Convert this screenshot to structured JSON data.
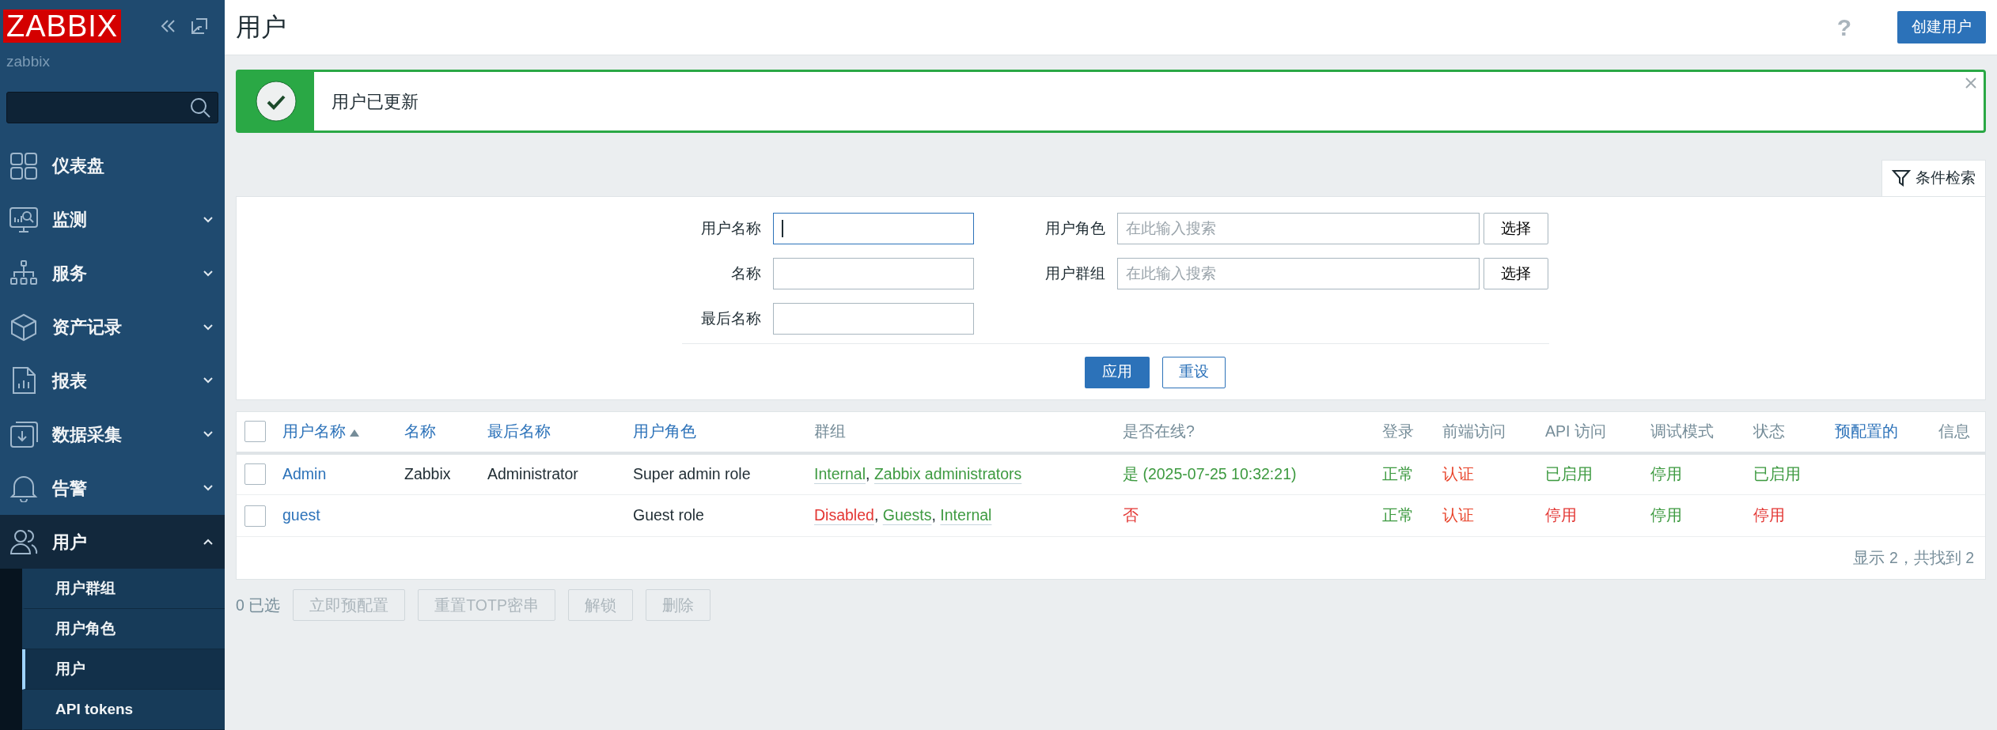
{
  "sidebar": {
    "logo": "ZABBIX",
    "server_name": "zabbix",
    "menu": [
      {
        "label": "仪表盘",
        "selected": false
      },
      {
        "label": "监测",
        "selected": false,
        "expanded": false
      },
      {
        "label": "服务",
        "selected": false,
        "expanded": false
      },
      {
        "label": "资产记录",
        "selected": false,
        "expanded": false
      },
      {
        "label": "报表",
        "selected": false,
        "expanded": false
      },
      {
        "label": "数据采集",
        "selected": false,
        "expanded": false
      },
      {
        "label": "告警",
        "selected": false,
        "expanded": false
      },
      {
        "label": "用户",
        "selected": true,
        "expanded": true,
        "children": [
          {
            "label": "用户群组",
            "selected": false
          },
          {
            "label": "用户角色",
            "selected": false
          },
          {
            "label": "用户",
            "selected": true
          },
          {
            "label": "API tokens",
            "selected": false
          }
        ]
      }
    ]
  },
  "header": {
    "title": "用户",
    "help": "?",
    "button": "创建用户"
  },
  "message": {
    "text": "用户已更新"
  },
  "filter": {
    "tab": "条件检索",
    "left_fields": [
      {
        "label": "用户名称",
        "focused": true
      },
      {
        "label": "名称",
        "focused": false
      },
      {
        "label": "最后名称",
        "focused": false
      }
    ],
    "right_fields": [
      {
        "label": "用户角色",
        "placeholder": "在此输入搜索",
        "button": "选择",
        "focused": false
      },
      {
        "label": "用户群组",
        "placeholder": "在此输入搜索",
        "button": "选择",
        "focused": false
      }
    ],
    "apply": "应用",
    "reset": "重设"
  },
  "table": {
    "all_checked": false,
    "columns": [
      {
        "label": "用户名称",
        "sortable": true,
        "sorted": true
      },
      {
        "label": "名称",
        "sortable": true,
        "sorted": false
      },
      {
        "label": "最后名称",
        "sortable": true,
        "sorted": false
      },
      {
        "label": "用户角色",
        "sortable": true,
        "sorted": false
      },
      {
        "label": "群组",
        "sortable": false,
        "sorted": false
      },
      {
        "label": "是否在线?",
        "sortable": false,
        "sorted": false
      },
      {
        "label": "登录",
        "sortable": false,
        "sorted": false
      },
      {
        "label": "前端访问",
        "sortable": false,
        "sorted": false
      },
      {
        "label": "API 访问",
        "sortable": false,
        "sorted": false
      },
      {
        "label": "调试模式",
        "sortable": false,
        "sorted": false
      },
      {
        "label": "状态",
        "sortable": false,
        "sorted": false
      },
      {
        "label": "预配置的",
        "sortable": true,
        "sorted": false
      },
      {
        "label": "信息",
        "sortable": false,
        "sorted": false
      }
    ],
    "rows": [
      {
        "checked": false,
        "username": "Admin",
        "name": "Zabbix",
        "surname": "Administrator",
        "role": "Super admin role",
        "groups": [
          {
            "name": "Internal",
            "color": "#3d9a40",
            "separator": ","
          },
          {
            "name": "Zabbix administrators",
            "color": "#3d9a40"
          }
        ],
        "online": {
          "text": "是 (2025-07-25 10:32:21)",
          "color": "#3d9a40"
        },
        "login": {
          "text": "正常",
          "color": "#3d9a40"
        },
        "frontend": {
          "text": "认证",
          "color": "#e8452c"
        },
        "api": {
          "text": "已启用",
          "color": "#3d9a40"
        },
        "debug": {
          "text": "停用",
          "color": "#3d9a40"
        },
        "status": {
          "text": "已启用",
          "color": "#3d9a40"
        }
      },
      {
        "checked": false,
        "username": "guest",
        "role": "Guest role",
        "groups": [
          {
            "name": "Disabled",
            "color": "#e33734",
            "separator": ","
          },
          {
            "name": "Guests",
            "color": "#3d9a40",
            "separator": ","
          },
          {
            "name": "Internal",
            "color": "#3d9a40"
          }
        ],
        "online": {
          "text": "否",
          "color": "#e33734"
        },
        "login": {
          "text": "正常",
          "color": "#3d9a40"
        },
        "frontend": {
          "text": "认证",
          "color": "#e8452c"
        },
        "api": {
          "text": "停用",
          "color": "#e33734"
        },
        "debug": {
          "text": "停用",
          "color": "#3d9a40"
        },
        "status": {
          "text": "停用",
          "color": "#e33734"
        }
      }
    ],
    "footer": "显示 2，共找到 2"
  },
  "actions": {
    "selected_count": "0 已选",
    "buttons": [
      {
        "label": "立即预配置",
        "disabled": true
      },
      {
        "label": "重置TOTP密串",
        "disabled": true
      },
      {
        "label": "解锁",
        "disabled": true
      },
      {
        "label": "删除",
        "disabled": true
      }
    ]
  }
}
